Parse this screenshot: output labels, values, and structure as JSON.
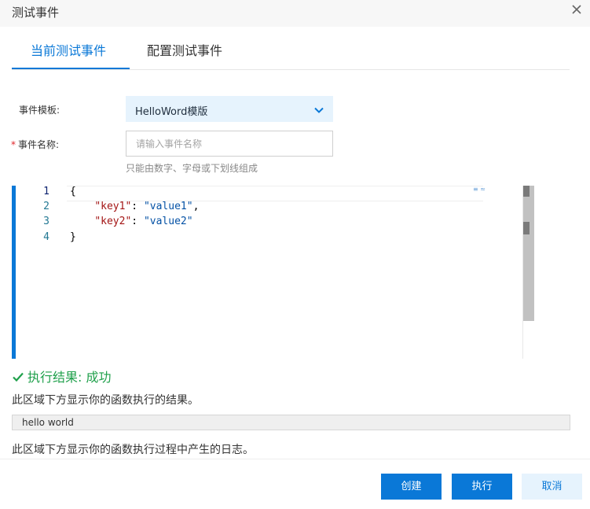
{
  "dialog": {
    "title": "测试事件"
  },
  "tabs": [
    {
      "label": "当前测试事件",
      "active": true
    },
    {
      "label": "配置测试事件",
      "active": false
    }
  ],
  "form": {
    "template_label": "事件模板:",
    "template_value": "HelloWord模版",
    "name_required_mark": "*",
    "name_label": "事件名称:",
    "name_placeholder": "请输入事件名称",
    "name_value": "",
    "name_hint": "只能由数字、字母或下划线组成"
  },
  "editor": {
    "lines": [
      {
        "num": "1",
        "text": "{"
      },
      {
        "num": "2",
        "key": "\"key1\"",
        "sep": ": ",
        "val": "\"value1\"",
        "tail": ","
      },
      {
        "num": "3",
        "key": "\"key2\"",
        "sep": ": ",
        "val": "\"value2\"",
        "tail": ""
      },
      {
        "num": "4",
        "text": "}"
      }
    ]
  },
  "result": {
    "title": "执行结果: 成功",
    "result_desc": "此区域下方显示你的函数执行的结果。",
    "output": "hello world",
    "log_desc": "此区域下方显示你的函数执行过程中产生的日志。"
  },
  "buttons": {
    "create": "创建",
    "run": "执行",
    "cancel": "取消"
  },
  "colors": {
    "accent": "#0a78d7",
    "success": "#1fa04b",
    "select_bg": "#e6f3fd",
    "required": "#e0262b"
  },
  "icons": {
    "close": "close-icon",
    "dropdown": "chevron-down-icon",
    "success": "check-icon"
  }
}
